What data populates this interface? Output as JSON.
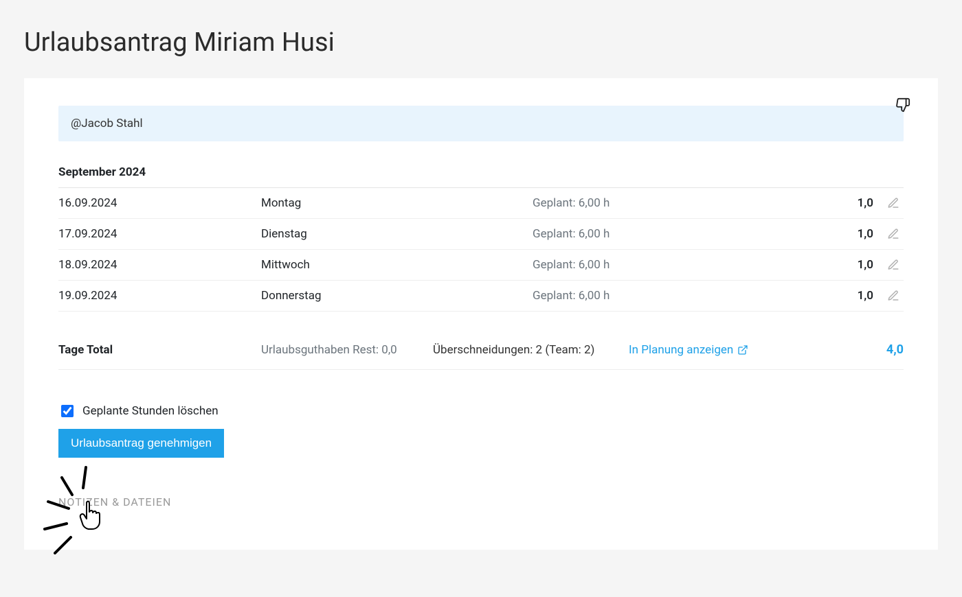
{
  "page_title": "Urlaubsantrag Miriam Husi",
  "mention": "@Jacob Stahl",
  "month_header": "September 2024",
  "rows": [
    {
      "date": "16.09.2024",
      "day": "Montag",
      "planned": "Geplant: 6,00 h",
      "amount": "1,0"
    },
    {
      "date": "17.09.2024",
      "day": "Dienstag",
      "planned": "Geplant: 6,00 h",
      "amount": "1,0"
    },
    {
      "date": "18.09.2024",
      "day": "Mittwoch",
      "planned": "Geplant: 6,00 h",
      "amount": "1,0"
    },
    {
      "date": "19.09.2024",
      "day": "Donnerstag",
      "planned": "Geplant: 6,00 h",
      "amount": "1,0"
    }
  ],
  "summary": {
    "label": "Tage Total",
    "rest": "Urlaubsguthaben Rest: 0,0",
    "overlaps": "Überschneidungen: 2 (Team: 2)",
    "link": "In Planung anzeigen",
    "total": "4,0"
  },
  "checkbox_label": "Geplante Stunden löschen",
  "approve_label": "Urlaubsantrag genehmigen",
  "notes_heading": "NOTIZEN & DATEIEN"
}
